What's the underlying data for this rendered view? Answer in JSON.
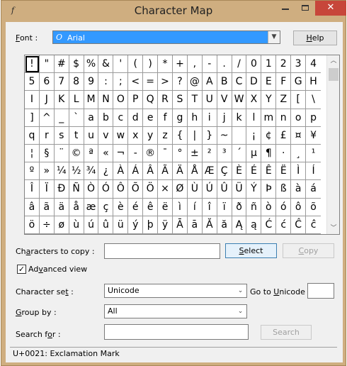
{
  "window": {
    "title": "Character Map",
    "min_glyph": "",
    "close_glyph": "✕"
  },
  "font": {
    "label_key": "F",
    "label_rest": "ont :",
    "value": "Arial",
    "icon": "truetype-font-icon",
    "icon_glyph": "O"
  },
  "help_button": {
    "key": "H",
    "rest": "elp"
  },
  "grid": {
    "selected_index": 0,
    "rows": [
      [
        "!",
        "\"",
        "#",
        "$",
        "%",
        "&",
        "'",
        "(",
        ")",
        "*",
        "+",
        ",",
        "-",
        ".",
        "/",
        "0",
        "1",
        "2",
        "3",
        "4"
      ],
      [
        "5",
        "6",
        "7",
        "8",
        "9",
        ":",
        ";",
        "<",
        "=",
        ">",
        "?",
        "@",
        "A",
        "B",
        "C",
        "D",
        "E",
        "F",
        "G",
        "H"
      ],
      [
        "I",
        "J",
        "K",
        "L",
        "M",
        "N",
        "O",
        "P",
        "Q",
        "R",
        "S",
        "T",
        "U",
        "V",
        "W",
        "X",
        "Y",
        "Z",
        "[",
        "\\"
      ],
      [
        "]",
        "^",
        "_",
        "`",
        "a",
        "b",
        "c",
        "d",
        "e",
        "f",
        "g",
        "h",
        "i",
        "j",
        "k",
        "l",
        "m",
        "n",
        "o",
        "p"
      ],
      [
        "q",
        "r",
        "s",
        "t",
        "u",
        "v",
        "w",
        "x",
        "y",
        "z",
        "{",
        "|",
        "}",
        "~",
        " ",
        "¡",
        "¢",
        "£",
        "¤",
        "¥"
      ],
      [
        "¦",
        "§",
        "¨",
        "©",
        "ª",
        "«",
        "¬",
        "-",
        "®",
        "¯",
        "°",
        "±",
        "²",
        "³",
        "´",
        "µ",
        "¶",
        "·",
        "¸",
        "¹"
      ],
      [
        "º",
        "»",
        "¼",
        "½",
        "¾",
        "¿",
        "À",
        "Á",
        "Â",
        "Ã",
        "Ä",
        "Å",
        "Æ",
        "Ç",
        "È",
        "É",
        "Ê",
        "Ë",
        "Ì",
        "Í"
      ],
      [
        "Î",
        "Ï",
        "Ð",
        "Ñ",
        "Ò",
        "Ó",
        "Ô",
        "Õ",
        "Ö",
        "×",
        "Ø",
        "Ù",
        "Ú",
        "Û",
        "Ü",
        "Ý",
        "Þ",
        "ß",
        "à",
        "á"
      ],
      [
        "â",
        "ã",
        "ä",
        "å",
        "æ",
        "ç",
        "è",
        "é",
        "ê",
        "ë",
        "ì",
        "í",
        "î",
        "ï",
        "ð",
        "ñ",
        "ò",
        "ó",
        "ô",
        "õ"
      ],
      [
        "ö",
        "÷",
        "ø",
        "ù",
        "ú",
        "û",
        "ü",
        "ý",
        "þ",
        "ÿ",
        "Ā",
        "ā",
        "Ă",
        "ă",
        "Ą",
        "ą",
        "Ć",
        "ć",
        "Ĉ",
        "ĉ"
      ]
    ]
  },
  "scroll": {
    "up_glyph": "︿",
    "down_glyph": "﹀"
  },
  "copy_row": {
    "label_a": "Ch",
    "label_key": "a",
    "label_rest": "racters to copy :",
    "value": "",
    "select_key": "S",
    "select_rest": "elect",
    "copy_key": "C",
    "copy_rest": "opy"
  },
  "advanced_view": {
    "checked_glyph": "✓",
    "label_a": "Ad",
    "label_key": "v",
    "label_rest": "anced view"
  },
  "character_set": {
    "label_a": "Character se",
    "label_key": "t",
    "label_rest": " :",
    "value": "Unicode",
    "goto_a": "Go to ",
    "goto_key": "U",
    "goto_rest": "nicode :",
    "goto_value": ""
  },
  "group_by": {
    "label_key": "G",
    "label_rest": "roup by :",
    "value": "All"
  },
  "search": {
    "label_a": "Search f",
    "label_key": "o",
    "label_rest": "r :",
    "value": "",
    "button": "Search"
  },
  "status": "U+0021: Exclamation Mark"
}
